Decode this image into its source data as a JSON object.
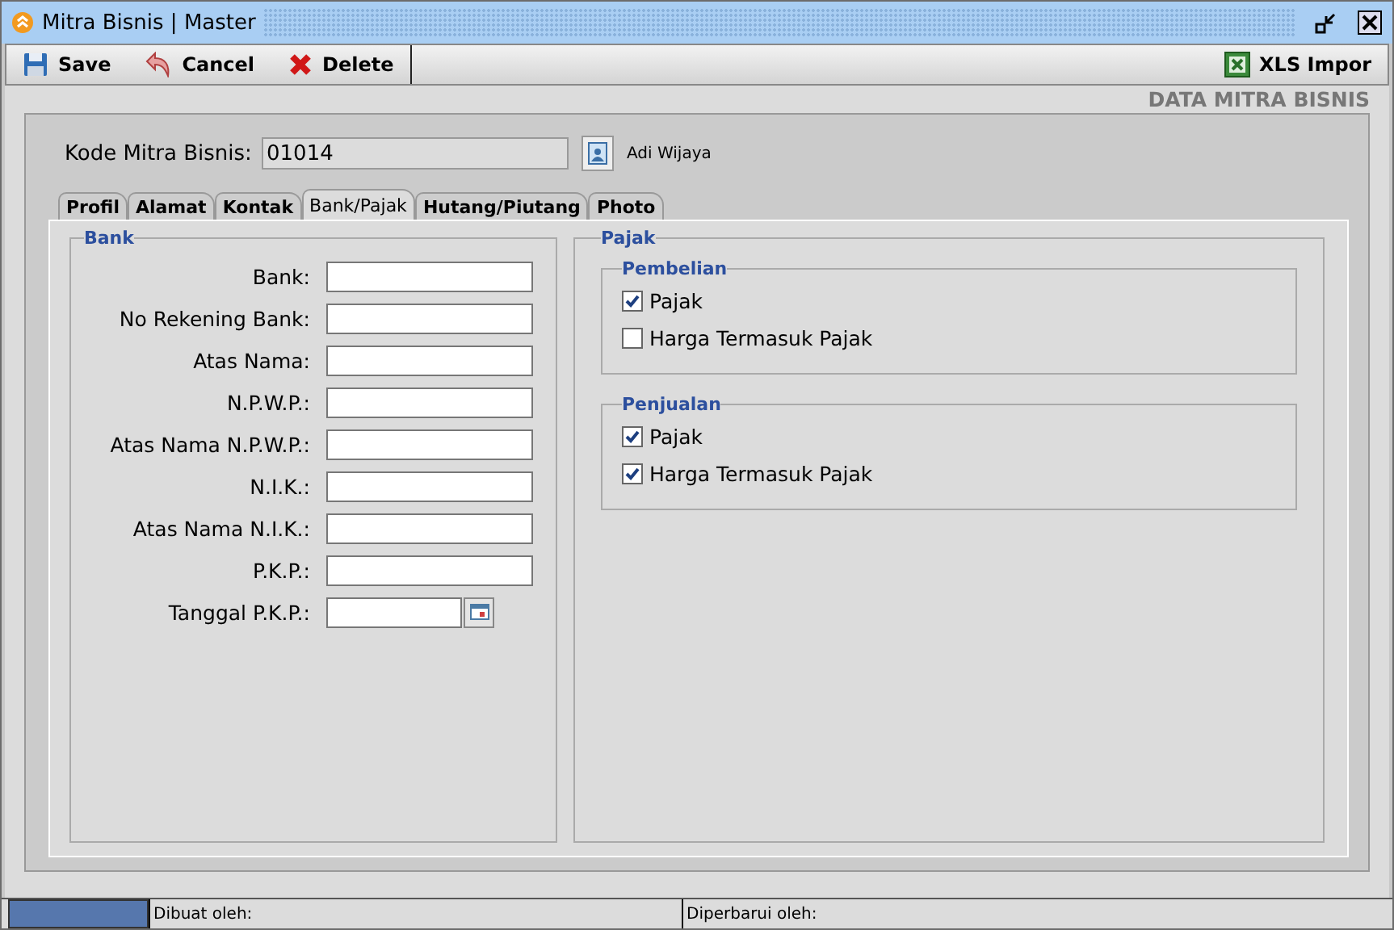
{
  "window": {
    "title": "Mitra Bisnis | Master"
  },
  "toolbar": {
    "left": [
      {
        "label": "Save",
        "kind": "save"
      },
      {
        "label": "Cancel",
        "kind": "cancel"
      },
      {
        "label": "Delete",
        "kind": "delete"
      }
    ],
    "right": [
      {
        "label": "XLS Impor",
        "kind": "xls"
      }
    ]
  },
  "heading": "DATA MITRA BISNIS",
  "kode": {
    "label": "Kode Mitra Bisnis:",
    "value": "01014",
    "name": "Adi Wijaya"
  },
  "tabs": [
    {
      "label": "Profil",
      "selected": false
    },
    {
      "label": "Alamat",
      "selected": false
    },
    {
      "label": "Kontak",
      "selected": false
    },
    {
      "label": "Bank/Pajak",
      "selected": true
    },
    {
      "label": "Hutang/Piutang",
      "selected": false
    },
    {
      "label": "Photo",
      "selected": false
    }
  ],
  "bank": {
    "title": "Bank",
    "fields": [
      {
        "label": "Bank:",
        "kind": "text"
      },
      {
        "label": "No Rekening Bank:",
        "kind": "text"
      },
      {
        "label": "Atas Nama:",
        "kind": "text"
      },
      {
        "label": "N.P.W.P.:",
        "kind": "text"
      },
      {
        "label": "Atas Nama N.P.W.P.:",
        "kind": "text"
      },
      {
        "label": "N.I.K.:",
        "kind": "text"
      },
      {
        "label": "Atas Nama N.I.K.:",
        "kind": "text"
      },
      {
        "label": "P.K.P.:",
        "kind": "text"
      },
      {
        "label": "Tanggal P.K.P.:",
        "kind": "date"
      }
    ]
  },
  "pajak": {
    "title": "Pajak",
    "groups": [
      {
        "title": "Pembelian",
        "options": [
          {
            "label": "Pajak",
            "checked": true
          },
          {
            "label": "Harga Termasuk Pajak",
            "checked": false
          }
        ]
      },
      {
        "title": "Penjualan",
        "options": [
          {
            "label": "Pajak",
            "checked": true
          },
          {
            "label": "Harga Termasuk Pajak",
            "checked": true
          }
        ]
      }
    ]
  },
  "status_bar": {
    "created": "Dibuat oleh:",
    "updated": "Diperbarui oleh:"
  }
}
